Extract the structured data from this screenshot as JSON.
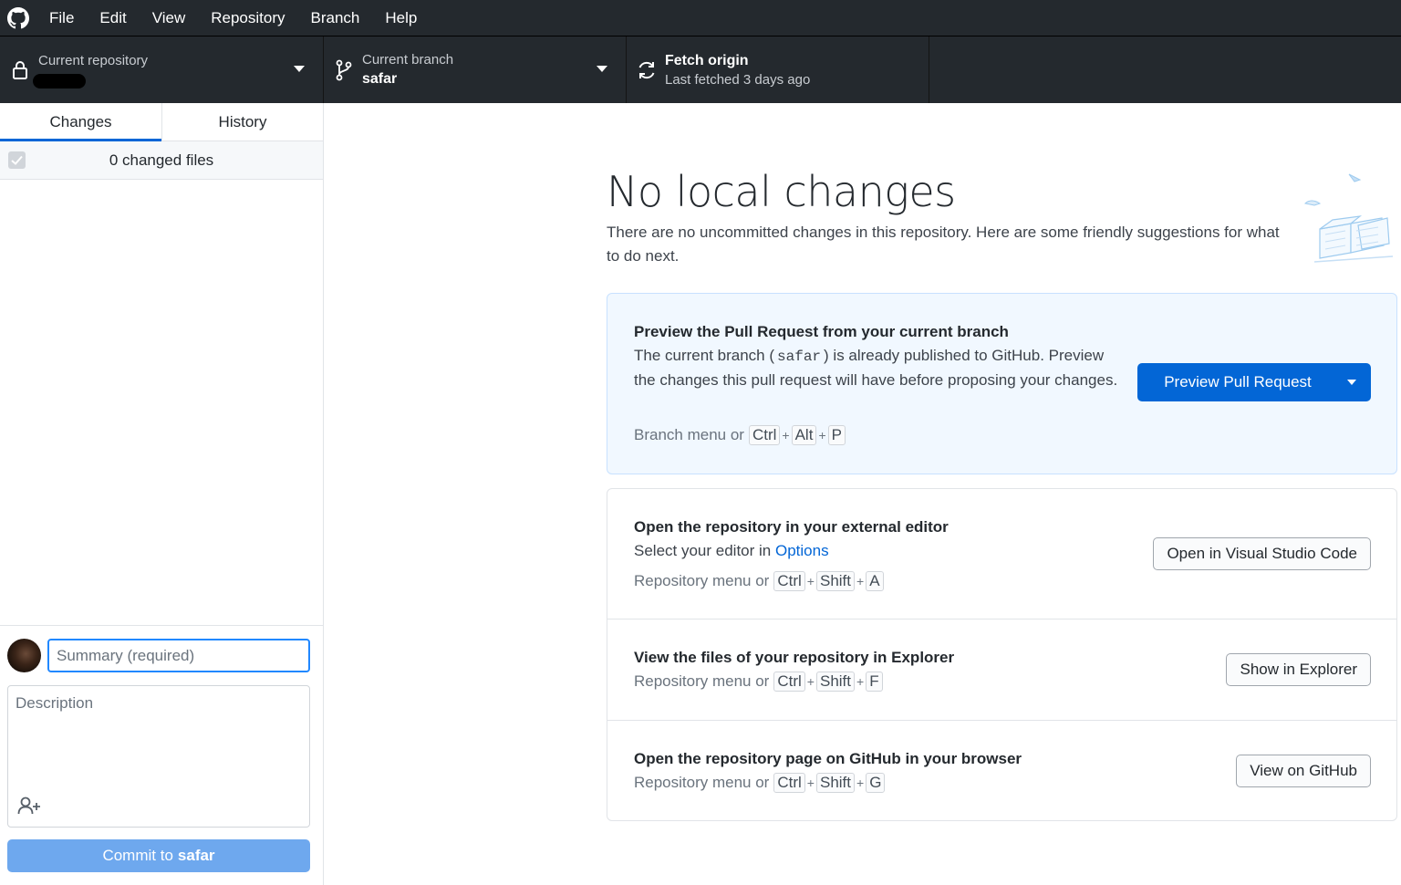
{
  "menu": {
    "items": [
      "File",
      "Edit",
      "View",
      "Repository",
      "Branch",
      "Help"
    ]
  },
  "toolbar": {
    "repository": {
      "label": "Current repository",
      "value": ""
    },
    "branch": {
      "label": "Current branch",
      "value": "safar"
    },
    "fetch": {
      "label": "Fetch origin",
      "status": "Last fetched 3 days ago"
    }
  },
  "sidebar": {
    "tabs": [
      "Changes",
      "History"
    ],
    "changed_files": "0 changed files",
    "commit": {
      "summary_placeholder": "Summary (required)",
      "description_placeholder": "Description",
      "button_prefix": "Commit to",
      "button_branch": "safar"
    }
  },
  "main": {
    "title": "No local changes",
    "subtitle": "There are no uncommitted changes in this repository. Here are some friendly suggestions for what to do next.",
    "pull_request": {
      "title": "Preview the Pull Request from your current branch",
      "desc_before": "The current branch (",
      "branch": "safar",
      "desc_after": ") is already published to GitHub. Preview the changes this pull request will have before proposing your changes.",
      "shortcut_prefix": "Branch menu or",
      "keys": [
        "Ctrl",
        "Alt",
        "P"
      ],
      "button": "Preview Pull Request"
    },
    "editor": {
      "title": "Open the repository in your external editor",
      "desc_before": "Select your editor in",
      "desc_link": "Options",
      "shortcut_prefix": "Repository menu or",
      "keys": [
        "Ctrl",
        "Shift",
        "A"
      ],
      "button": "Open in Visual Studio Code"
    },
    "explorer": {
      "title": "View the files of your repository in Explorer",
      "shortcut_prefix": "Repository menu or",
      "keys": [
        "Ctrl",
        "Shift",
        "F"
      ],
      "button": "Show in Explorer"
    },
    "github": {
      "title": "Open the repository page on GitHub in your browser",
      "shortcut_prefix": "Repository menu or",
      "keys": [
        "Ctrl",
        "Shift",
        "G"
      ],
      "button": "View on GitHub"
    }
  },
  "colors": {
    "toolbar_bg": "#24292e",
    "accent": "#0366d6",
    "commit_button": "#6ea8ee",
    "primary_card_bg": "#f1f8ff"
  },
  "icons": [
    "github-logo-icon",
    "lock-icon",
    "branch-icon",
    "sync-icon",
    "caret-down-icon",
    "check-icon",
    "add-coauthor-icon",
    "empty-state-illustration"
  ]
}
